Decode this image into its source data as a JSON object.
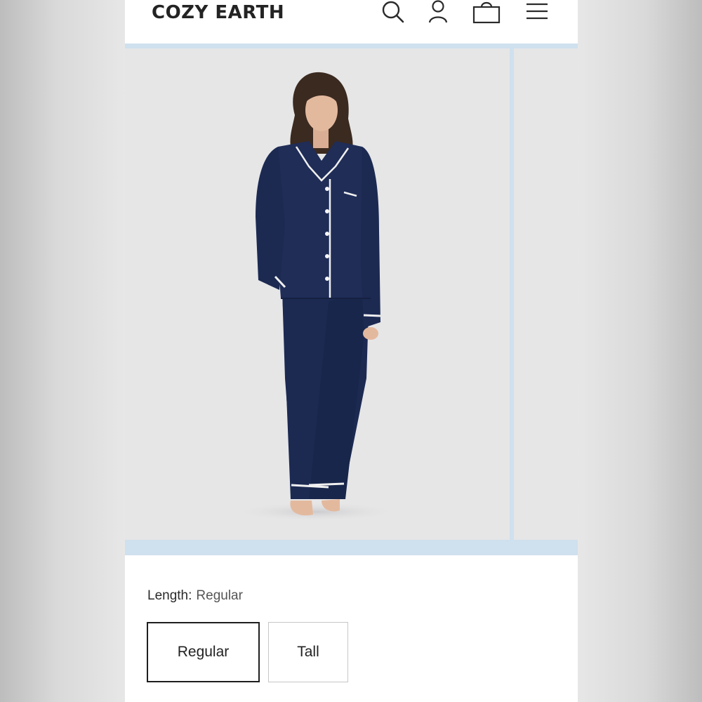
{
  "header": {
    "brand": "COZY EARTH",
    "icons": [
      "search-icon",
      "account-icon",
      "bag-icon",
      "menu-icon"
    ]
  },
  "colors": {
    "accent_bar": "#cfe0ee",
    "pajama_navy": "#1c2a52",
    "photo_background": "#e6e6e7"
  },
  "product": {
    "length_label": "Length:",
    "length_value": "Regular",
    "length_options": [
      "Regular",
      "Tall"
    ],
    "selected_option": "Regular"
  }
}
